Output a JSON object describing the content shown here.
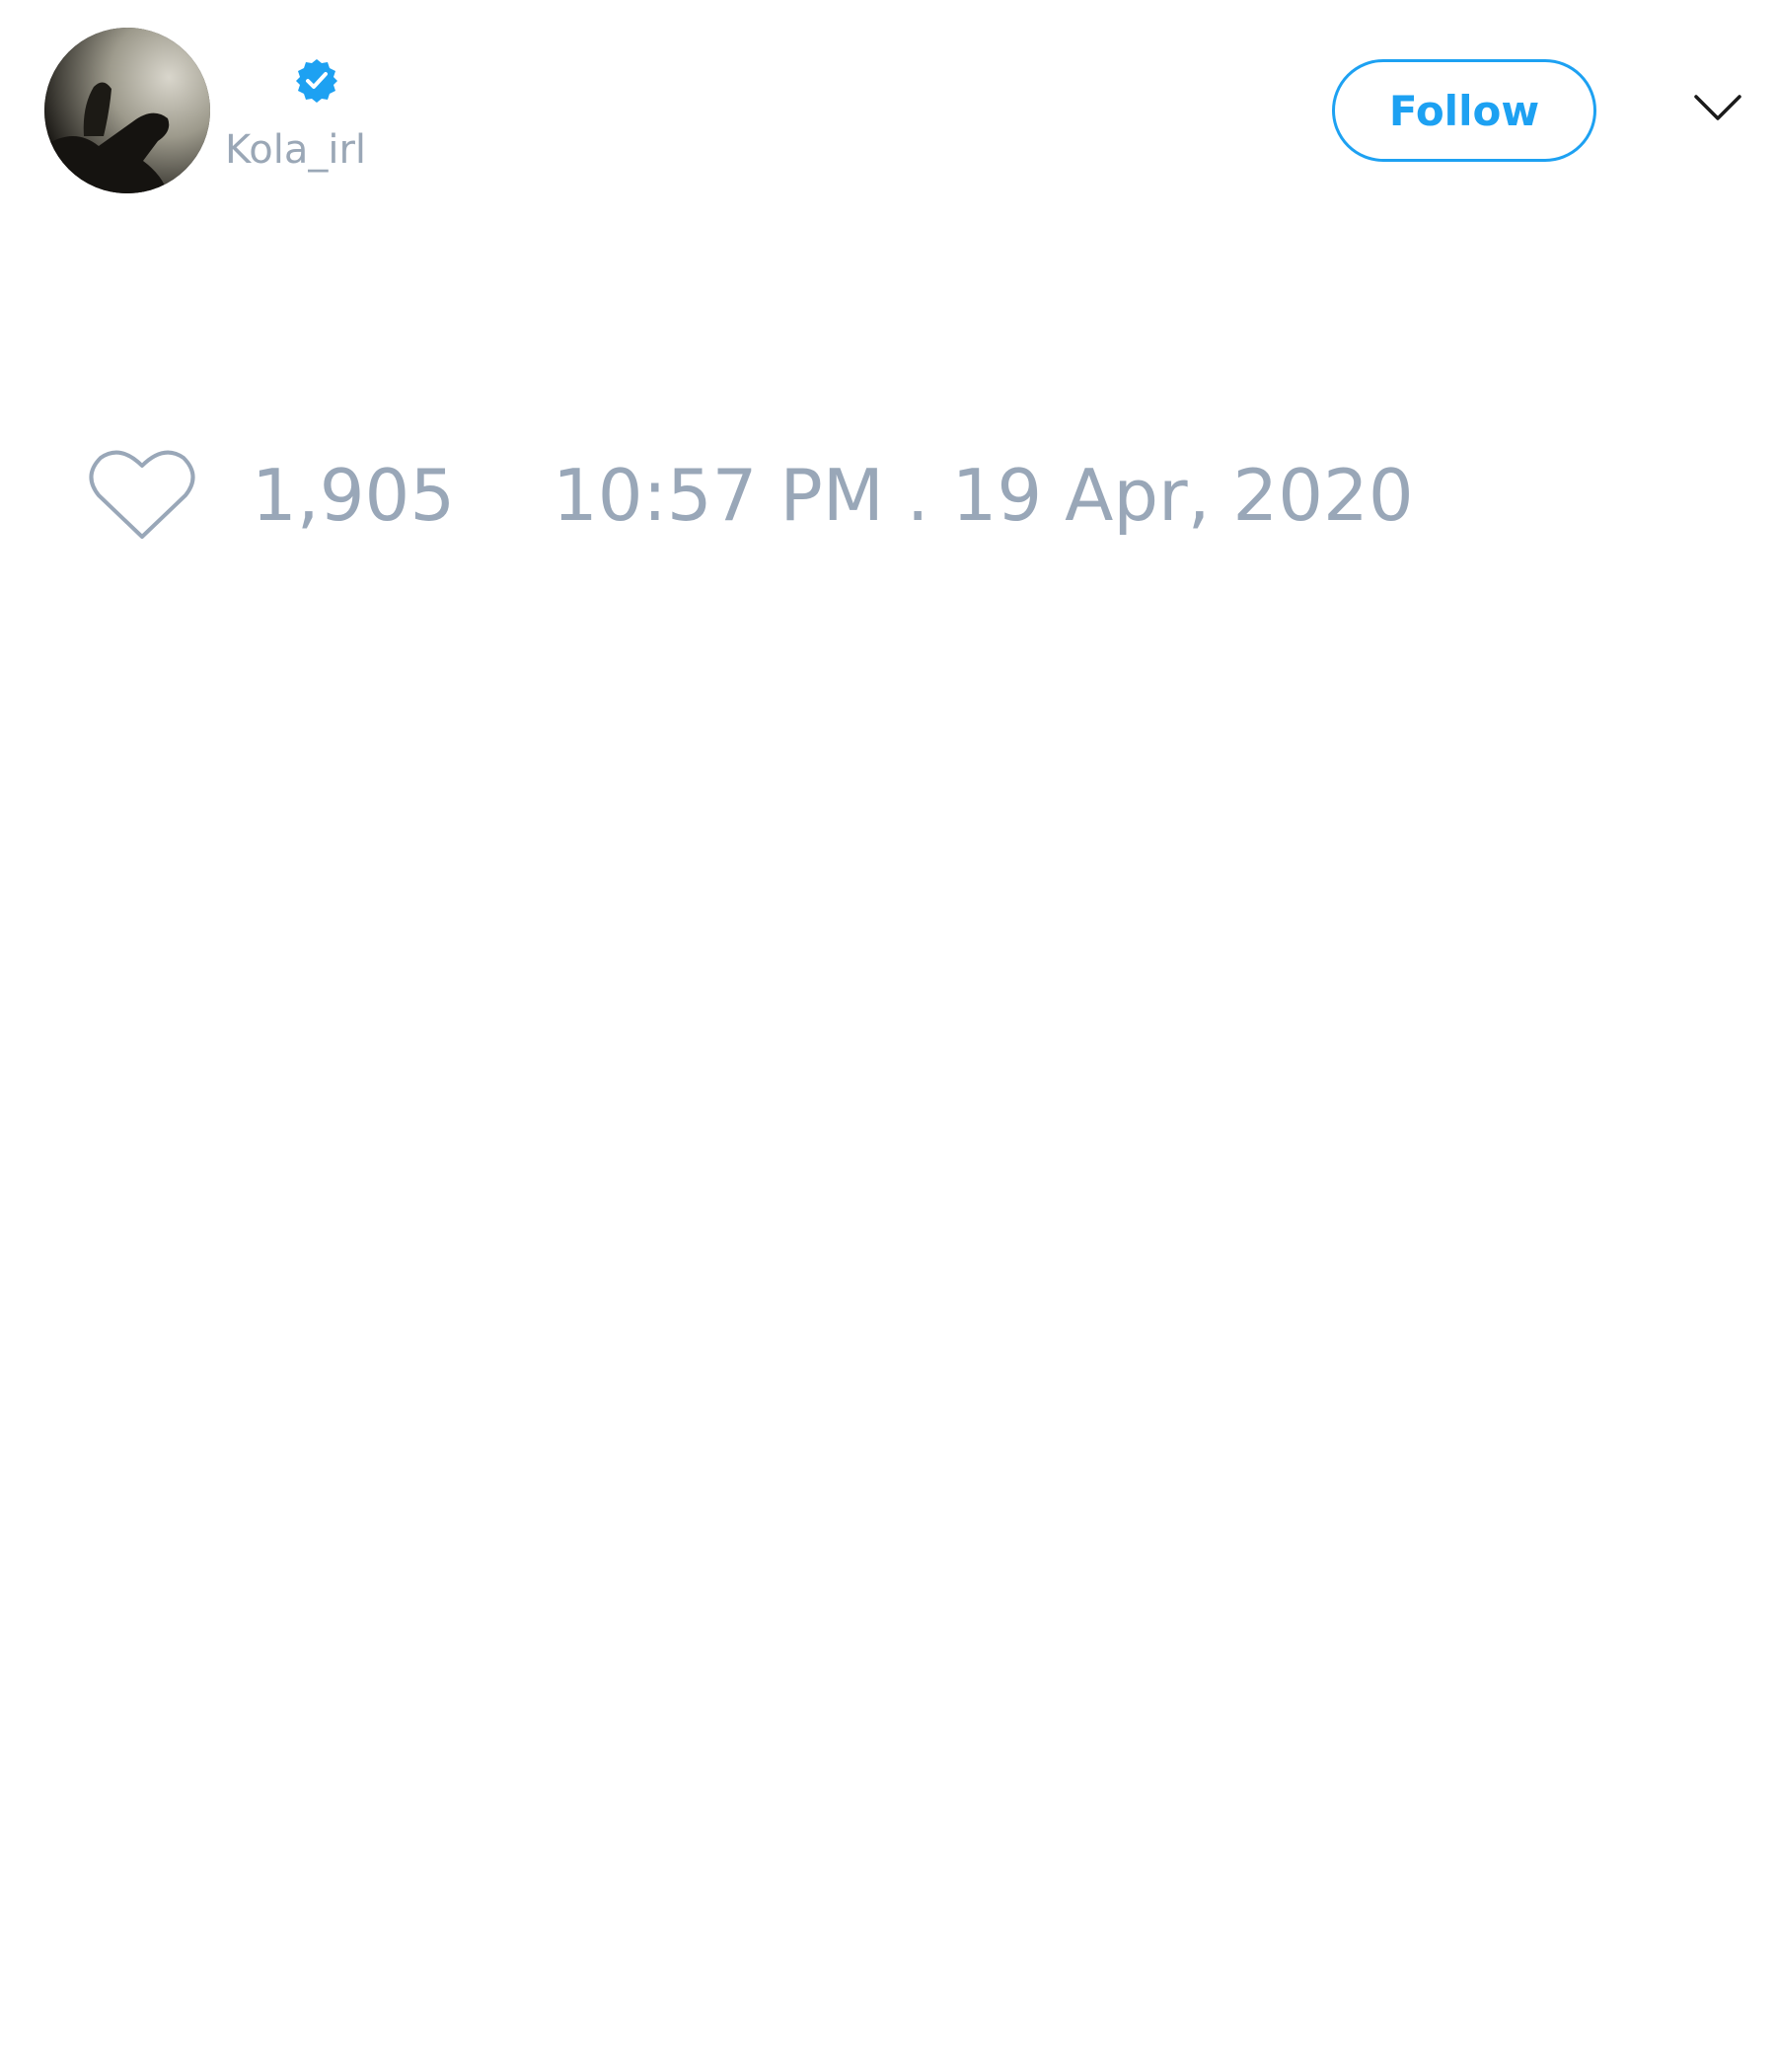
{
  "author": {
    "handle": "Kola_irl",
    "verified": true
  },
  "actions": {
    "follow_label": "Follow"
  },
  "tweet": {
    "like_count": "1,905",
    "timestamp": "10:57 PM . 19 Apr, 2020"
  },
  "icons": {
    "verified": "verified-badge-icon",
    "menu": "chevron-down-icon",
    "like": "heart-icon"
  },
  "colors": {
    "accent": "#1da1f2",
    "muted_text": "#99a7b8",
    "background": "#ffffff"
  }
}
